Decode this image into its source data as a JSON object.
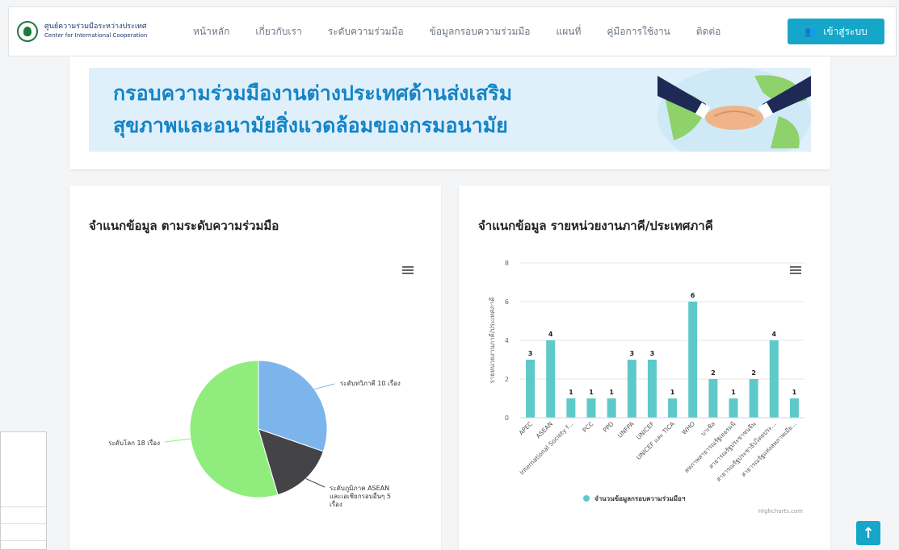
{
  "header": {
    "org_name_th": "ศูนย์ความร่วมมือระหว่างประเทศ",
    "org_name_en": "Center for International Cooperation",
    "nav": [
      {
        "label": "หน้าหลัก",
        "name": "nav-home"
      },
      {
        "label": "เกี่ยวกับเรา",
        "name": "nav-about"
      },
      {
        "label": "ระดับความร่วมมือ",
        "name": "nav-cooperation-level"
      },
      {
        "label": "ข้อมูลกรอบความร่วมมือ",
        "name": "nav-framework-data"
      },
      {
        "label": "แผนที่",
        "name": "nav-map"
      },
      {
        "label": "คู่มือการใช้งาน",
        "name": "nav-manual"
      },
      {
        "label": "ติดต่อ",
        "name": "nav-contact"
      }
    ],
    "login_label": "เข้าสู่ระบบ"
  },
  "banner": {
    "line1": "กรอบความร่วมมืองานต่างประเทศด้านส่งเสริม",
    "line2": "สุขภาพและอนามัยสิ่งแวดล้อมของกรมอนามัย"
  },
  "left_card": {
    "title": "จำแนกข้อมูล ตามระดับความร่วมมือ"
  },
  "right_card": {
    "title": "จำแนกข้อมูล รายหน่วยงานภาคี/ประเทศภาคี",
    "credit": "Highcharts.com"
  },
  "colors": {
    "accent": "#16a6c9",
    "banner_text": "#1584c7",
    "bar": "#5ec9c9"
  },
  "chart_data": [
    {
      "type": "pie",
      "title": "",
      "slices": [
        {
          "label": "ระดับทวิภาคี 10 เรื่อง",
          "value": 10,
          "color": "#7cb5ec"
        },
        {
          "label_lines": [
            "ระดับภูมิภาค ASEAN",
            "และเอเชียกรอบอื่นๆ 5",
            "เรื่อง"
          ],
          "value": 5,
          "color": "#434348"
        },
        {
          "label": "ระดับโลก 18 เรื่อง",
          "value": 18,
          "color": "#90ed7d"
        }
      ]
    },
    {
      "type": "bar",
      "title": "",
      "ylabel": "รายหน่วยงานภาคี/ประเทศภาคี",
      "ylim": [
        0,
        8
      ],
      "yticks": [
        0,
        2,
        4,
        6,
        8
      ],
      "categories": [
        "APEC",
        "ASEAN",
        "International Society f...",
        "PCC",
        "PPD",
        "UNFPA",
        "UNICEF",
        "UNICEF และ TICA",
        "WHO",
        "บาเชิล",
        "สหภาพสาธารณรัฐเยอรมนี",
        "สาธารณรัฐประชาชนจีน",
        "สาธารณรัฐประชาธิปไตยประ...",
        "สาธารณรัฐแห่งสหภาพเมีย..."
      ],
      "series": [
        {
          "name": "จำนวนข้อมูลกรอบความร่วมมือฯ",
          "values": [
            3,
            4,
            1,
            1,
            1,
            3,
            3,
            1,
            6,
            2,
            1,
            2,
            4,
            1
          ]
        }
      ],
      "grid": true,
      "legend": "bottom-center"
    }
  ]
}
